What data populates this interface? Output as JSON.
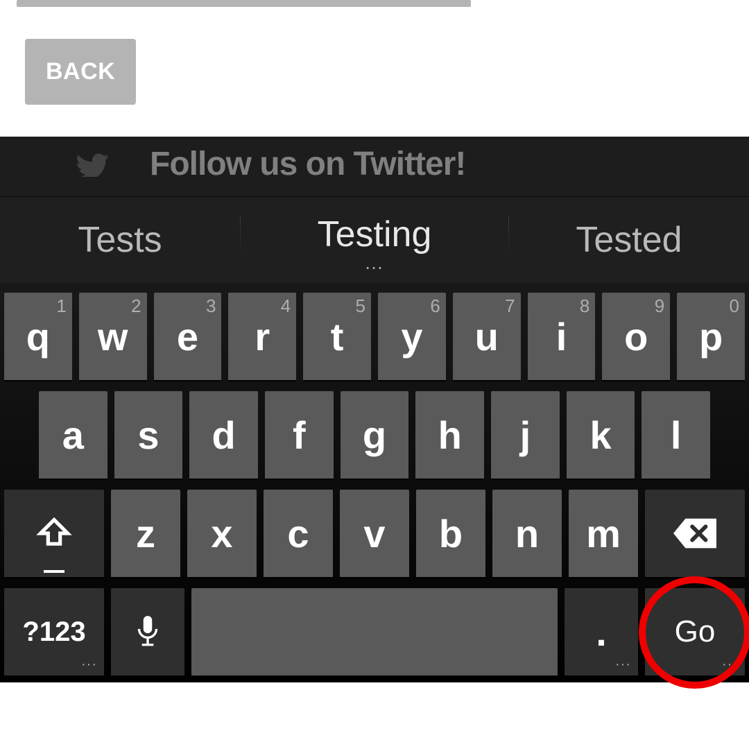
{
  "top": {
    "back_label": "BACK",
    "twitter_text": "Follow us on Twitter!"
  },
  "suggestions": {
    "left": "Tests",
    "center": "Testing",
    "center_more": "…",
    "right": "Tested"
  },
  "row1": [
    {
      "letter": "q",
      "super": "1"
    },
    {
      "letter": "w",
      "super": "2"
    },
    {
      "letter": "e",
      "super": "3"
    },
    {
      "letter": "r",
      "super": "4"
    },
    {
      "letter": "t",
      "super": "5"
    },
    {
      "letter": "y",
      "super": "6"
    },
    {
      "letter": "u",
      "super": "7"
    },
    {
      "letter": "i",
      "super": "8"
    },
    {
      "letter": "o",
      "super": "9"
    },
    {
      "letter": "p",
      "super": "0"
    }
  ],
  "row2": [
    {
      "letter": "a"
    },
    {
      "letter": "s"
    },
    {
      "letter": "d"
    },
    {
      "letter": "f"
    },
    {
      "letter": "g"
    },
    {
      "letter": "h"
    },
    {
      "letter": "j"
    },
    {
      "letter": "k"
    },
    {
      "letter": "l"
    }
  ],
  "row3": [
    {
      "letter": "z"
    },
    {
      "letter": "x"
    },
    {
      "letter": "c"
    },
    {
      "letter": "v"
    },
    {
      "letter": "b"
    },
    {
      "letter": "n"
    },
    {
      "letter": "m"
    }
  ],
  "row4": {
    "symbols": "?123",
    "period": ".",
    "go": "Go"
  },
  "highlight_circle": {
    "target": "go-key"
  }
}
